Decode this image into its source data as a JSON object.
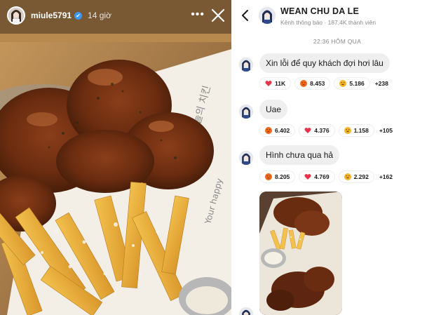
{
  "story": {
    "username": "miule5791",
    "time_ago": "14 giờ",
    "verified_icon": "✔",
    "more_icon": "•••",
    "close_icon": "close-icon"
  },
  "channel": {
    "name": "WEAN CHU DA LE",
    "subtitle": "Kênh thông báo · 187,4K thành viên",
    "timestamp": "22:36 HÔM QUA",
    "messages": [
      {
        "text": "Xin lỗi để quy khách đợi hơi lâu",
        "reactions": [
          {
            "emoji": "heart",
            "count": "11K"
          },
          {
            "emoji": "angry",
            "count": "8.453"
          },
          {
            "emoji": "laugh",
            "count": "5.186"
          }
        ],
        "more": "+238"
      },
      {
        "text": "Uae",
        "reactions": [
          {
            "emoji": "angry",
            "count": "6.402"
          },
          {
            "emoji": "heart",
            "count": "4.376"
          },
          {
            "emoji": "laugh",
            "count": "1.158"
          }
        ],
        "more": "+105"
      },
      {
        "text": "Hình chưa qua hả",
        "reactions": [
          {
            "emoji": "angry",
            "count": "8.205"
          },
          {
            "emoji": "heart",
            "count": "4.769"
          },
          {
            "emoji": "laugh",
            "count": "2.292"
          }
        ],
        "more": "+162"
      }
    ]
  },
  "colors": {
    "heart": "#e8334a",
    "angry": "#f26a1b",
    "laugh": "#f5b72a",
    "bubble": "#efefef",
    "verified": "#3b97f5"
  }
}
